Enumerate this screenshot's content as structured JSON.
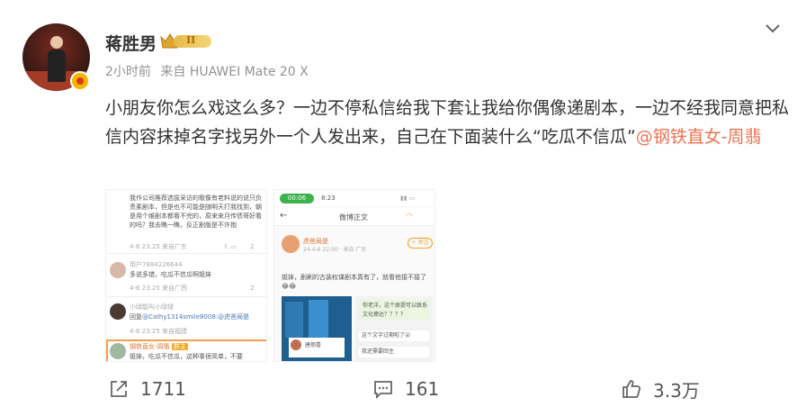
{
  "post": {
    "username": "蒋胜男",
    "rank_level": "II",
    "time": "2小时前",
    "source": "来自 HUAWEI Mate 20 X",
    "text_main": "小朋友你怎么戏这么多？一边不停私信给我下套让我给你偶像递剧本，一边不经我同意把私信内容抹掉名字找另外一个人发出来，自己在下面装什么“吃瓜不信瓜”",
    "mention": "@钢铁直女-周翡"
  },
  "image1": {
    "quote_text": "我作公司推荐选拔采访的歌像有老料说的说只负责素剧本，但是也不可能是随明天打我找到，朝是用个维剧本都看不完的，原来来月传债哥好看的吗？我去瞧一瞧，反正剧版是不许抱",
    "quote_time": "4-6 23:25 来自广东",
    "quote_like": "2",
    "c1_user": "用户7884226644",
    "c1_text": "多说多错，吃瓜不信瓜啊姐妹",
    "c1_time": "4-6 23:25 来自广西",
    "c1_like": "2",
    "c2_user": "小绿能叫小绿绿",
    "c2_text_prefix": "回复",
    "c2_text_mention": "@Cathy1314smile8008:@虎爸局是",
    "c2_time": "4-6 23:25 来自福建",
    "c3_user": "钢铁直女-周翡",
    "c3_badge": "群主",
    "c3_text": "姐妹，吃瓜不信瓜，这种事很简单，不要"
  },
  "image2": {
    "status_time": "00:06",
    "status_clock": "8:23",
    "nav_title": "微博正文",
    "author": "虎爸局是",
    "author_time": "24-4-6 22:00 · 来自 广东",
    "follow": "+ 关注",
    "body": "姐妹，剧刷的古装权谋剧本真有了，就看他接不接了😂😂",
    "chat1": "你老洋，这个原提可以联系文化撩达？？？？",
    "chat2": "这个文字过期啦了😮",
    "chat3": "我还需要回主",
    "card_name": "唐丽喜"
  },
  "actions": {
    "repost_count": "1711",
    "comment_count": "161",
    "like_count": "3.3万"
  },
  "colors": {
    "mention": "#eb7350",
    "text": "#333333",
    "meta": "#939393"
  }
}
